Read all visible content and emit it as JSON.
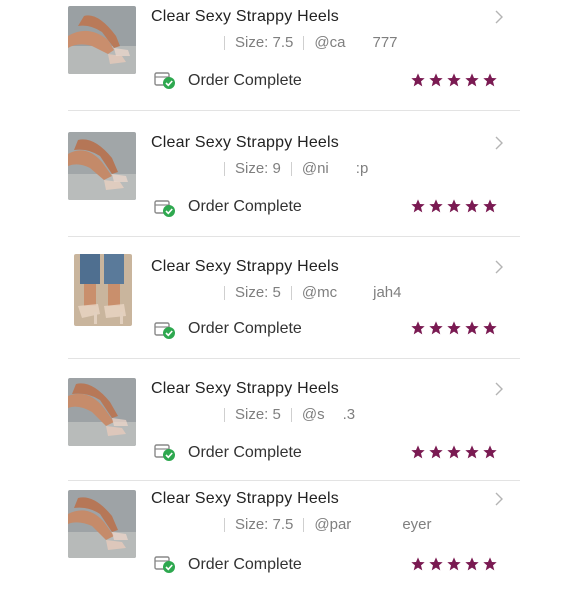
{
  "colors": {
    "star": "#7a1a52",
    "check_green": "#2ea84f",
    "title": "#222222",
    "meta": "#7f7f7f"
  },
  "orders": [
    {
      "title": "Clear Sexy Strappy Heels",
      "size": "Size: 7.5",
      "user": "@ca         777",
      "status": "Order Complete",
      "rating": 5,
      "thumb_icon": "heels-photo-icon"
    },
    {
      "title": "Clear Sexy Strappy Heels",
      "size": "Size: 9",
      "user": "@ni         :p",
      "status": "Order Complete",
      "rating": 5,
      "thumb_icon": "heels-photo-icon"
    },
    {
      "title": "Clear Sexy Strappy Heels",
      "size": "Size: 5",
      "user": "@mc            jah4",
      "status": "Order Complete",
      "rating": 5,
      "thumb_icon": "heels-photo-icon"
    },
    {
      "title": "Clear Sexy Strappy Heels",
      "size": "Size: 5",
      "user": "@s      .3",
      "status": "Order Complete",
      "rating": 5,
      "thumb_icon": "heels-photo-icon"
    },
    {
      "title": "Clear Sexy Strappy Heels",
      "size": "Size: 7.5",
      "user": "@par                 eyer",
      "status": "Order Complete",
      "rating": 5,
      "thumb_icon": "heels-photo-icon"
    }
  ]
}
